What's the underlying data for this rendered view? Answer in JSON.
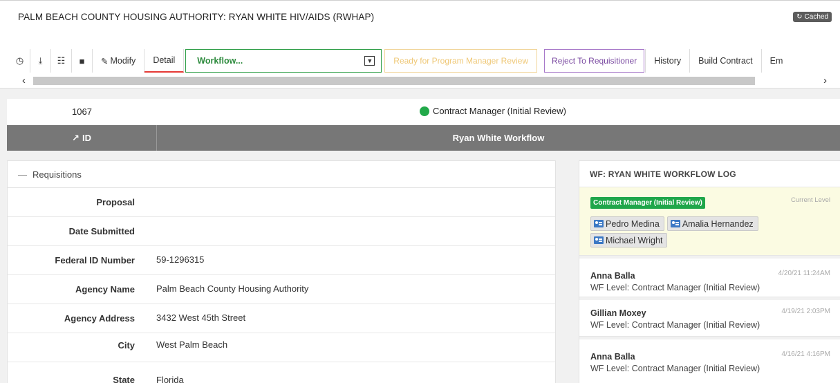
{
  "header": {
    "title": "PALM BEACH COUNTY HOUSING AUTHORITY: RYAN WHITE HIV/AIDS (RWHAP)",
    "cached_label": "Cached"
  },
  "toolbar": {
    "icons": [
      "clock-icon",
      "download-icon",
      "qr-icon",
      "trash-icon"
    ],
    "modify_label": "Modify",
    "detail_label": "Detail",
    "workflow_value": "Workflow...",
    "ready_label": "Ready for Program Manager Review",
    "reject_label": "Reject To Requisitioner",
    "history_label": "History",
    "build_contract_label": "Build Contract",
    "overflow_label": "Em"
  },
  "record": {
    "id": "1067",
    "status": "Contract Manager (Initial Review)",
    "status_color": "#22a94a"
  },
  "grid_header": {
    "id_label": "ID",
    "workflow_label": "Ryan White Workflow"
  },
  "requisitions": {
    "title": "Requisitions",
    "fields": [
      {
        "label": "Proposal",
        "value": ""
      },
      {
        "label": "Date Submitted",
        "value": ""
      },
      {
        "label": "Federal ID Number",
        "value": "59-1296315"
      },
      {
        "label": "Agency Name",
        "value": "Palm Beach County Housing Authority"
      },
      {
        "label": "Agency Address",
        "value": "3432 West 45th Street"
      },
      {
        "label": "City",
        "value": "West Palm Beach"
      },
      {
        "label": "State",
        "value": "Florida"
      }
    ]
  },
  "workflow_log": {
    "title": "WF: RYAN WHITE WORKFLOW LOG",
    "current": {
      "level": "Contract Manager (Initial Review)",
      "tag": "Current Level",
      "assignees": [
        "Pedro Medina",
        "Amalia Hernandez",
        "Michael Wright"
      ]
    },
    "entries": [
      {
        "user": "Anna Balla",
        "time": "4/20/21 11:24AM",
        "level": "WF Level: Contract Manager (Initial Review)"
      },
      {
        "user": "Gillian Moxey",
        "time": "4/19/21 2:03PM",
        "level": "WF Level: Contract Manager (Initial Review)"
      },
      {
        "user": "Anna Balla",
        "time": "4/16/21 4:16PM",
        "level": "WF Level: Contract Manager (Initial Review)"
      }
    ]
  }
}
